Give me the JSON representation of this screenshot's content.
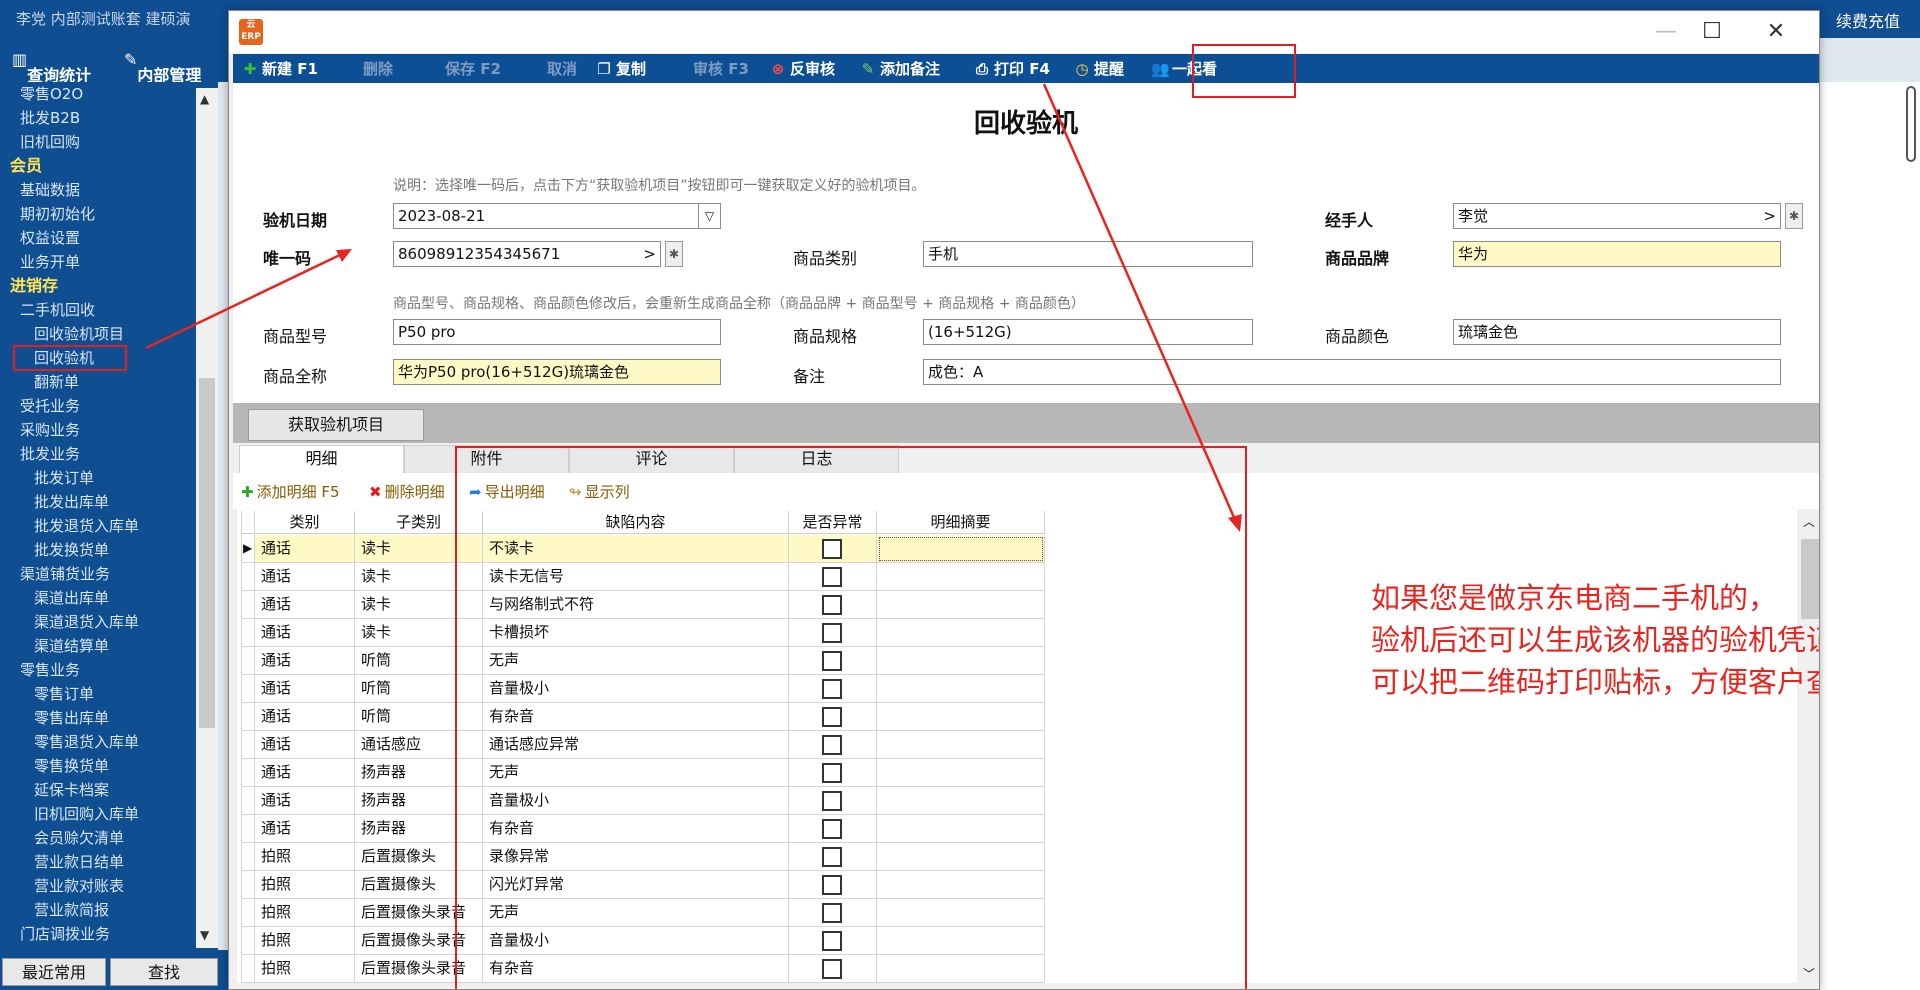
{
  "topbar": {
    "left_text": "李党  内部测试账套   建硕演",
    "right_text": "续费充值"
  },
  "navbar": {
    "stats": "查询统计",
    "internal": "内部管理"
  },
  "sidebar": {
    "items": [
      {
        "label": "零售O2O",
        "level": "lv1"
      },
      {
        "label": "批发B2B",
        "level": "lv1"
      },
      {
        "label": "旧机回购",
        "level": "lv1"
      },
      {
        "label": "会员",
        "level": "sec"
      },
      {
        "label": "基础数据",
        "level": "lv1"
      },
      {
        "label": "期初初始化",
        "level": "lv1"
      },
      {
        "label": "权益设置",
        "level": "lv1"
      },
      {
        "label": "业务开单",
        "level": "lv1"
      },
      {
        "label": "进销存",
        "level": "sec"
      },
      {
        "label": "二手机回收",
        "level": "lv1"
      },
      {
        "label": "回收验机项目",
        "level": "lv2"
      },
      {
        "label": "回收验机",
        "level": "lv2",
        "active": true
      },
      {
        "label": "翻新单",
        "level": "lv2"
      },
      {
        "label": "受托业务",
        "level": "lv1"
      },
      {
        "label": "采购业务",
        "level": "lv1"
      },
      {
        "label": "批发业务",
        "level": "lv1"
      },
      {
        "label": "批发订单",
        "level": "lv2"
      },
      {
        "label": "批发出库单",
        "level": "lv2"
      },
      {
        "label": "批发退货入库单",
        "level": "lv2"
      },
      {
        "label": "批发换货单",
        "level": "lv2"
      },
      {
        "label": "渠道铺货业务",
        "level": "lv1"
      },
      {
        "label": "渠道出库单",
        "level": "lv2"
      },
      {
        "label": "渠道退货入库单",
        "level": "lv2"
      },
      {
        "label": "渠道结算单",
        "level": "lv2"
      },
      {
        "label": "零售业务",
        "level": "lv1"
      },
      {
        "label": "零售订单",
        "level": "lv2"
      },
      {
        "label": "零售出库单",
        "level": "lv2"
      },
      {
        "label": "零售退货入库单",
        "level": "lv2"
      },
      {
        "label": "零售换货单",
        "level": "lv2"
      },
      {
        "label": "延保卡档案",
        "level": "lv2"
      },
      {
        "label": "旧机回购入库单",
        "level": "lv2"
      },
      {
        "label": "会员赊欠清单",
        "level": "lv2"
      },
      {
        "label": "营业款日结单",
        "level": "lv2"
      },
      {
        "label": "营业款对账表",
        "level": "lv2"
      },
      {
        "label": "营业款简报",
        "level": "lv2"
      },
      {
        "label": "门店调拨业务",
        "level": "lv1"
      }
    ],
    "recent": "最近常用",
    "find": "查找"
  },
  "window": {
    "logo_text": "云 ERP"
  },
  "toolbar": {
    "new": "新建 F1",
    "delete": "删除",
    "save": "保存 F2",
    "cancel": "取消",
    "copy": "复制",
    "audit": "审核 F3",
    "unaudit": "反审核",
    "add_note": "添加备注",
    "print": "打印 F4",
    "remind": "提醒",
    "watch": "一起看"
  },
  "form": {
    "title": "回收验机",
    "note1": "说明：选择唯一码后，点击下方“获取验机项目”按钮即可一键获取定义好的验机项目。",
    "note2": "商品型号、商品规格、商品颜色修改后，会重新生成商品全称（商品品牌 + 商品型号 + 商品规格 + 商品颜色）",
    "date_label": "验机日期",
    "date_value": "2023-08-21",
    "handler_label": "经手人",
    "handler_value": "李觉",
    "code_label": "唯一码",
    "code_value": "86098912354345671",
    "category_label": "商品类别",
    "category_value": "手机",
    "brand_label": "商品品牌",
    "brand_value": "华为",
    "model_label": "商品型号",
    "model_value": "P50 pro",
    "spec_label": "商品规格",
    "spec_value": "(16+512G)",
    "color_label": "商品颜色",
    "color_value": "琉璃金色",
    "fullname_label": "商品全称",
    "fullname_value": "华为P50 pro(16+512G)琉璃金色",
    "remark_label": "备注",
    "remark_value": "成色：A"
  },
  "fetch_button": "获取验机项目",
  "tabs": [
    "明细",
    "附件",
    "评论",
    "日志"
  ],
  "subtoolbar": {
    "add": "添加明细 F5",
    "delete": "删除明细",
    "export": "导出明细",
    "columns": "显示列"
  },
  "table": {
    "headers": [
      "类别",
      "子类别",
      "缺陷内容",
      "是否异常",
      "明细摘要"
    ],
    "rows": [
      [
        "通话",
        "读卡",
        "不读卡"
      ],
      [
        "通话",
        "读卡",
        "读卡无信号"
      ],
      [
        "通话",
        "读卡",
        "与网络制式不符"
      ],
      [
        "通话",
        "读卡",
        "卡槽损坏"
      ],
      [
        "通话",
        "听筒",
        "无声"
      ],
      [
        "通话",
        "听筒",
        "音量极小"
      ],
      [
        "通话",
        "听筒",
        "有杂音"
      ],
      [
        "通话",
        "通话感应",
        "通话感应异常"
      ],
      [
        "通话",
        "扬声器",
        "无声"
      ],
      [
        "通话",
        "扬声器",
        "音量极小"
      ],
      [
        "通话",
        "扬声器",
        "有杂音"
      ],
      [
        "拍照",
        "后置摄像头",
        "录像异常"
      ],
      [
        "拍照",
        "后置摄像头",
        "闪光灯异常"
      ],
      [
        "拍照",
        "后置摄像头录音",
        "无声"
      ],
      [
        "拍照",
        "后置摄像头录音",
        "音量极小"
      ],
      [
        "拍照",
        "后置摄像头录音",
        "有杂音"
      ]
    ]
  },
  "annotation": {
    "line1": "如果您是做京东电商二手机的，",
    "line2": "验机后还可以生成该机器的验机凭证二维码",
    "line3": "可以把二维码打印贴标，方便客户查阅"
  },
  "colors": {
    "accent_red": "#e02020",
    "toolbar_blue": "#0d4f94",
    "highlight_yellow": "#fff9c6"
  }
}
